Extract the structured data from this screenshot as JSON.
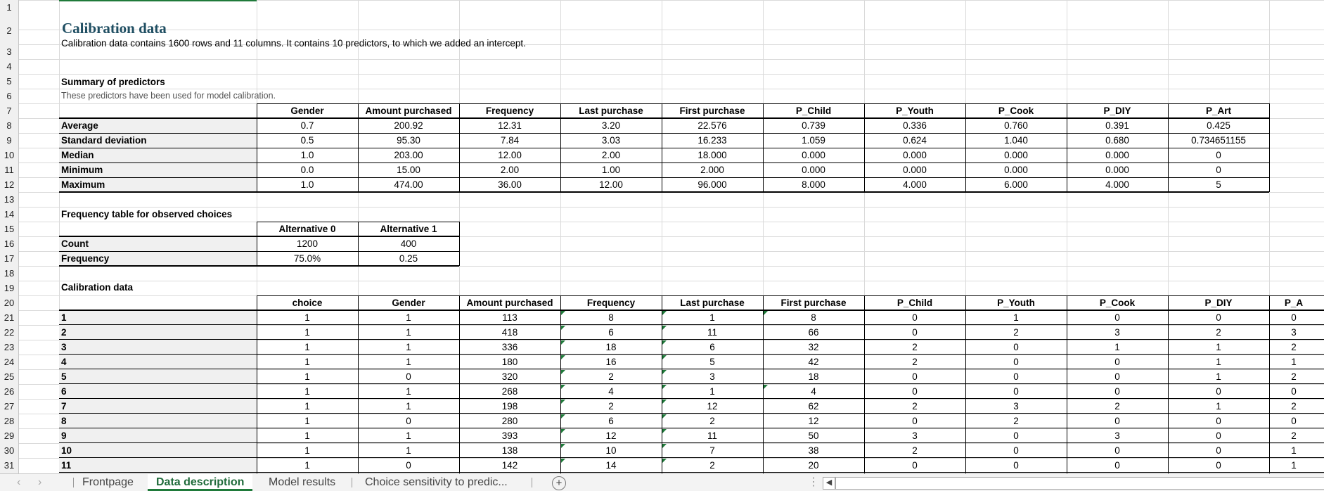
{
  "title": "Calibration data",
  "description": "Calibration data contains 1600 rows and 11 columns. It contains 10 predictors, to which we added an intercept.",
  "summary": {
    "title": "Summary of predictors",
    "note": "These predictors have been used for model calibration.",
    "headers": [
      "Gender",
      "Amount purchased",
      "Frequency",
      "Last purchase",
      "First purchase",
      "P_Child",
      "P_Youth",
      "P_Cook",
      "P_DIY",
      "P_Art"
    ],
    "rows": [
      {
        "label": "Average",
        "values": [
          "0.7",
          "200.92",
          "12.31",
          "3.20",
          "22.576",
          "0.739",
          "0.336",
          "0.760",
          "0.391",
          "0.425"
        ]
      },
      {
        "label": "Standard deviation",
        "values": [
          "0.5",
          "95.30",
          "7.84",
          "3.03",
          "16.233",
          "1.059",
          "0.624",
          "1.040",
          "0.680",
          "0.734651155"
        ]
      },
      {
        "label": "Median",
        "values": [
          "1.0",
          "203.00",
          "12.00",
          "2.00",
          "18.000",
          "0.000",
          "0.000",
          "0.000",
          "0.000",
          "0"
        ]
      },
      {
        "label": "Minimum",
        "values": [
          "0.0",
          "15.00",
          "2.00",
          "1.00",
          "2.000",
          "0.000",
          "0.000",
          "0.000",
          "0.000",
          "0"
        ]
      },
      {
        "label": "Maximum",
        "values": [
          "1.0",
          "474.00",
          "36.00",
          "12.00",
          "96.000",
          "8.000",
          "4.000",
          "6.000",
          "4.000",
          "5"
        ]
      }
    ]
  },
  "freq": {
    "title": "Frequency table for observed choices",
    "headers": [
      "Alternative 0",
      "Alternative 1"
    ],
    "rows": [
      {
        "label": "Count",
        "values": [
          "1200",
          "400"
        ]
      },
      {
        "label": "Frequency",
        "values": [
          "75.0%",
          "0.25"
        ]
      }
    ]
  },
  "calib": {
    "title": "Calibration data",
    "headers": [
      "choice",
      "Gender",
      "Amount purchased",
      "Frequency",
      "Last purchase",
      "First purchase",
      "P_Child",
      "P_Youth",
      "P_Cook",
      "P_DIY",
      "P_A"
    ],
    "rows": [
      {
        "label": "1",
        "values": [
          "1",
          "1",
          "113",
          "8",
          "1",
          "8",
          "0",
          "1",
          "0",
          "0",
          "0"
        ]
      },
      {
        "label": "2",
        "values": [
          "1",
          "1",
          "418",
          "6",
          "11",
          "66",
          "0",
          "2",
          "3",
          "2",
          "3"
        ]
      },
      {
        "label": "3",
        "values": [
          "1",
          "1",
          "336",
          "18",
          "6",
          "32",
          "2",
          "0",
          "1",
          "1",
          "2"
        ]
      },
      {
        "label": "4",
        "values": [
          "1",
          "1",
          "180",
          "16",
          "5",
          "42",
          "2",
          "0",
          "0",
          "1",
          "1"
        ]
      },
      {
        "label": "5",
        "values": [
          "1",
          "0",
          "320",
          "2",
          "3",
          "18",
          "0",
          "0",
          "0",
          "1",
          "2"
        ]
      },
      {
        "label": "6",
        "values": [
          "1",
          "1",
          "268",
          "4",
          "1",
          "4",
          "0",
          "0",
          "0",
          "0",
          "0"
        ]
      },
      {
        "label": "7",
        "values": [
          "1",
          "1",
          "198",
          "2",
          "12",
          "62",
          "2",
          "3",
          "2",
          "1",
          "2"
        ]
      },
      {
        "label": "8",
        "values": [
          "1",
          "0",
          "280",
          "6",
          "2",
          "12",
          "0",
          "2",
          "0",
          "0",
          "0"
        ]
      },
      {
        "label": "9",
        "values": [
          "1",
          "1",
          "393",
          "12",
          "11",
          "50",
          "3",
          "0",
          "3",
          "0",
          "2"
        ]
      },
      {
        "label": "10",
        "values": [
          "1",
          "1",
          "138",
          "10",
          "7",
          "38",
          "2",
          "0",
          "0",
          "0",
          "1"
        ]
      },
      {
        "label": "11",
        "values": [
          "1",
          "0",
          "142",
          "14",
          "2",
          "20",
          "0",
          "0",
          "0",
          "0",
          "1"
        ]
      }
    ]
  },
  "row_numbers": [
    "1",
    "2",
    "3",
    "4",
    "5",
    "6",
    "7",
    "8",
    "9",
    "10",
    "11",
    "12",
    "13",
    "14",
    "15",
    "16",
    "17",
    "18",
    "19",
    "20",
    "21",
    "22",
    "23",
    "24",
    "25",
    "26",
    "27",
    "28",
    "29",
    "30",
    "31"
  ],
  "tabs": [
    "Frontpage",
    "Data description",
    "Model results",
    "Choice sensitivity to predic..."
  ],
  "active_tab": "Data description",
  "add_sheet_symbol": "+",
  "nav_prev": "‹",
  "nav_next": "›",
  "colors": {
    "accent": "#1f7a3a",
    "title": "#1f4e62",
    "label_fill": "#f0f0f0"
  }
}
